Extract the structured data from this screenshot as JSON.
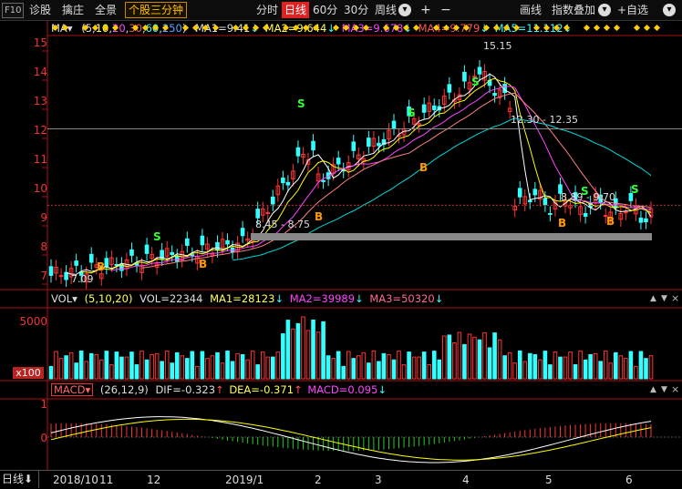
{
  "toolbar": {
    "f10": "F10",
    "diagnose": "诊股",
    "pick": "擒庄",
    "panorama": "全景",
    "stock_3min": "个股三分钟",
    "timeshare": "分时",
    "daily": "日线",
    "min60": "60分",
    "min30": "30分",
    "weekly": "周线",
    "weekly_arrow": "▾",
    "plus": "+",
    "minus": "−",
    "draw": "画线",
    "index_overlay": "指数叠加",
    "index_overlay_arrow": "▾",
    "watchlist": "+自选",
    "watchlist_arrow": "▾",
    "colors": {
      "active_bg": "#dd2222",
      "orange": "#ffc000"
    }
  },
  "price_panel": {
    "ma_label": "MA▾",
    "ma_params_open": "(",
    "ma_params": [
      "5",
      "10",
      "20",
      "30",
      "60",
      "250"
    ],
    "ma_params_close": ")",
    "ma1": "MA1=9.41",
    "ma2": "MA2=9.644",
    "ma3": "MA3=9.678",
    "ma4": "MA4=9.779",
    "ma5": "MA5=11.112",
    "y_ticks": [
      "15",
      "14",
      "13",
      "12",
      "11",
      "10",
      "9",
      "8",
      "7"
    ],
    "high_label": "15.15",
    "low_label": "7.09",
    "range_label_1": "12.30 - 12.35",
    "range_label_2": "8.45 - 8.75",
    "range_label_3": "8.89 - 9.70",
    "signal_s": "S",
    "signal_b": "B",
    "colors": {
      "up": "#ff3333",
      "down": "#33ffff",
      "ma1": "#ffffff",
      "ma2": "#ffff00",
      "ma3": "#ff44ff",
      "ma4": "#ff8080",
      "ma5": "#00e0e0"
    }
  },
  "volume_panel": {
    "label": "VOL▾",
    "params": "(5,10,20)",
    "vol": "VOL=22344",
    "ma1": "MA1=28123",
    "ma2": "MA2=39989",
    "ma3": "MA3=50320",
    "y_tick": "5000",
    "unit": "x100"
  },
  "macd_panel": {
    "label": "MACD▾",
    "params": "(26,12,9)",
    "dif": "DIF=-0.323",
    "dea": "DEA=-0.371",
    "macd": "MACD=0.095",
    "y_ticks": [
      "1",
      "0"
    ]
  },
  "bottom": {
    "period": "日线",
    "period_icon": "⬇",
    "x_labels": [
      "2018/10",
      "11",
      "12",
      "2019/1",
      "2",
      "3",
      "4",
      "5",
      "6"
    ]
  },
  "arrows": {
    "down": "↓",
    "up": "↑"
  },
  "panel_buttons": {
    "up": "▲",
    "down": "▼",
    "close": "×"
  }
}
